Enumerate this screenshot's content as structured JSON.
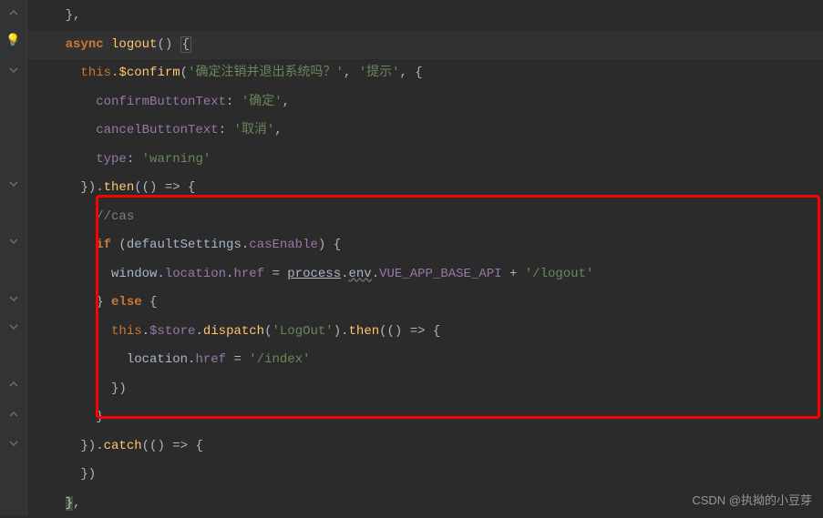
{
  "code": {
    "l1": "    },",
    "l2_p1": "    ",
    "l2_async": "async",
    "l2_logout": " logout",
    "l2_p2": "() ",
    "l2_brace": "{",
    "l3_p1": "      ",
    "l3_this": "this",
    "l3_p2": ".",
    "l3_confirm": "$confirm",
    "l3_p3": "(",
    "l3_str1": "'确定注销并退出系统吗？'",
    "l3_p4": ", ",
    "l3_str2": "'提示'",
    "l3_p5": ", {",
    "l4_p1": "        ",
    "l4_key": "confirmButtonText",
    "l4_p2": ": ",
    "l4_str": "'确定'",
    "l4_p3": ",",
    "l5_p1": "        ",
    "l5_key": "cancelButtonText",
    "l5_p2": ": ",
    "l5_str": "'取消'",
    "l5_p3": ",",
    "l6_p1": "        ",
    "l6_key": "type",
    "l6_p2": ": ",
    "l6_str": "'warning'",
    "l7_p1": "      }).",
    "l7_then": "then",
    "l7_p2": "(() => {",
    "l8_p1": "        ",
    "l8_cm": "//cas",
    "l9_p1": "        ",
    "l9_if": "if",
    "l9_p2": " (defaultSettings.",
    "l9_cas": "casEnable",
    "l9_p3": ") {",
    "l10_p1": "          window.",
    "l10_loc": "location",
    "l10_p2": ".",
    "l10_href": "href",
    "l10_p3": " = ",
    "l10_proc": "process",
    "l10_p4": ".",
    "l10_env": "env",
    "l10_p5": ".",
    "l10_api": "VUE_APP_BASE_API",
    "l10_p6": " + ",
    "l10_str": "'/logout'",
    "l11_p1": "        } ",
    "l11_else": "else",
    "l11_p2": " {",
    "l12_p1": "          ",
    "l12_this": "this",
    "l12_p2": ".",
    "l12_store": "$store",
    "l12_p3": ".",
    "l12_disp": "dispatch",
    "l12_p4": "(",
    "l12_str": "'LogOut'",
    "l12_p5": ").",
    "l12_then": "then",
    "l12_p6": "(() => {",
    "l13_p1": "            location.",
    "l13_href": "href",
    "l13_p2": " = ",
    "l13_str": "'/index'",
    "l14": "          })",
    "l15": "        }",
    "l16_p1": "      }).",
    "l16_catch": "catch",
    "l16_p2": "(() => {",
    "l17": "      })",
    "l18_p1": "    ",
    "l18_brace": "}",
    "l18_p2": ","
  },
  "watermark": "CSDN @执拗的小豆芽"
}
